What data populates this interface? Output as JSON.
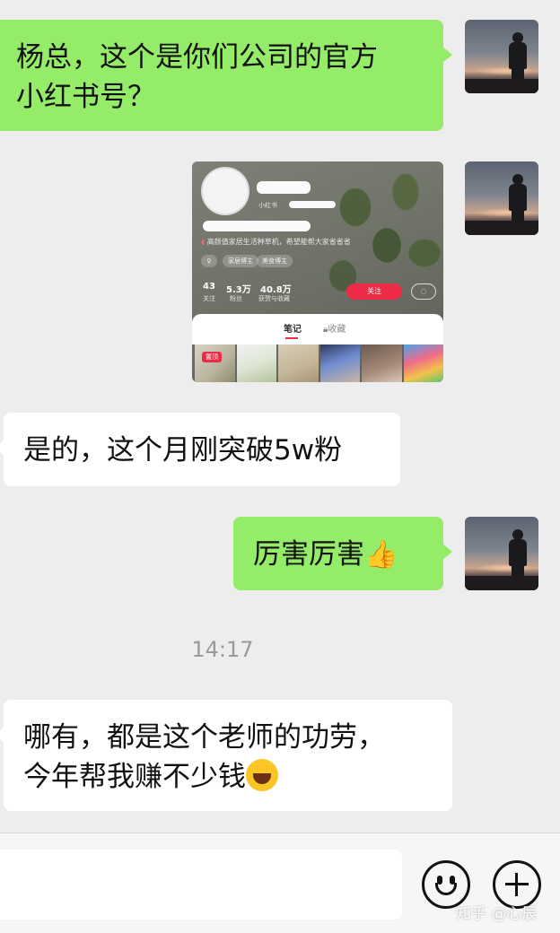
{
  "messages": [
    {
      "side": "right",
      "text": "杨总，这个是你们公司的官方\n小红书号？"
    },
    {
      "side": "right",
      "type": "shared-card"
    },
    {
      "side": "left",
      "text": "是的，这个月刚突破5w粉"
    },
    {
      "side": "right",
      "text": "厉害厉害",
      "emoji": "👍"
    },
    {
      "side": "left",
      "text_line1": "哪有，都是这个老师的功劳，",
      "text_line2": "今年帮我赚不少钱",
      "emoji": "laughing-tears-emoji"
    }
  ],
  "timestamp": "14:17",
  "card": {
    "platform_label": "小红书",
    "bio": "高颜值家居生活种草机，希望能帮大家省省省",
    "tags": [
      "家居博主",
      "美食博主"
    ],
    "stats": [
      {
        "num": "43",
        "label": "关注"
      },
      {
        "num": "5.3万",
        "label": "粉丝"
      },
      {
        "num": "40.8万",
        "label": "获赞与收藏"
      }
    ],
    "follow_label": "关注",
    "tabs": [
      "笔记",
      "收藏"
    ],
    "pinned_label": "置顶"
  },
  "watermark": "知乎 @心辰",
  "colors": {
    "chat_bg": "#ededed",
    "bubble_green": "#95ec69",
    "bubble_white": "#ffffff",
    "accent_red": "#ee2b47"
  }
}
